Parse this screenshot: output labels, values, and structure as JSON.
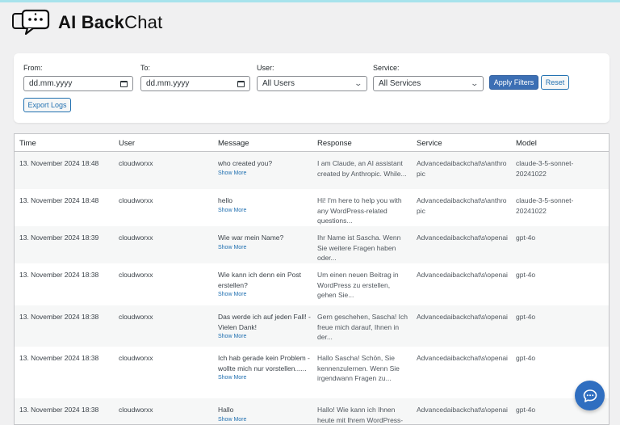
{
  "app": {
    "brand_bold": "AI Back",
    "brand_light": "Chat"
  },
  "filters": {
    "from_label": "From:",
    "from_value": "dd.mm.yyyy",
    "to_label": "To:",
    "to_value": "dd.mm.yyyy",
    "user_label": "User:",
    "user_value": "All Users",
    "service_label": "Service:",
    "service_value": "All Services",
    "apply_label": "Apply Filters",
    "reset_label": "Reset",
    "export_label": "Export Logs"
  },
  "table": {
    "headers": [
      "Time",
      "User",
      "Message",
      "Response",
      "Service",
      "Model"
    ],
    "show_more": "Show More",
    "rows": [
      {
        "time": "13. November 2024 18:48",
        "user": "cloudworxx",
        "message": "who created you?",
        "response": "I am Claude, an AI assistant created by Anthropic. While...",
        "service": "Advancedaibackchat\\s\\anthropic",
        "model": "claude-3-5-sonnet-20241022"
      },
      {
        "time": "13. November 2024 18:48",
        "user": "cloudworxx",
        "message": "hello",
        "response": "Hi! I'm here to help you with any WordPress-related questions...",
        "service": "Advancedaibackchat\\s\\anthropic",
        "model": "claude-3-5-sonnet-20241022"
      },
      {
        "time": "13. November 2024 18:39",
        "user": "cloudworxx",
        "message": "Wie war mein Name?",
        "response": "Ihr Name ist Sascha. Wenn Sie weitere Fragen haben oder...",
        "service": "Advancedaibackchat\\s\\openai",
        "model": "gpt-4o"
      },
      {
        "time": "13. November 2024 18:38",
        "user": "cloudworxx",
        "message": "Wie kann ich denn ein Post erstellen?",
        "response": "Um einen neuen Beitrag in WordPress zu erstellen, gehen Sie...",
        "service": "Advancedaibackchat\\s\\openai",
        "model": "gpt-4o"
      },
      {
        "time": "13. November 2024 18:38",
        "user": "cloudworxx",
        "message": "Das werde ich auf jeden Fall! - Vielen Dank!",
        "response": "Gern geschehen, Sascha! Ich freue mich darauf, Ihnen in der...",
        "service": "Advancedaibackchat\\s\\openai",
        "model": "gpt-4o"
      },
      {
        "time": "13. November 2024 18:38",
        "user": "cloudworxx",
        "message": "Ich hab gerade kein Problem - wollte mich nur vorstellen......",
        "response": "Hallo Sascha! Schön, Sie kennenzulernen. Wenn Sie irgendwann Fragen zu...",
        "service": "Advancedaibackchat\\s\\openai",
        "model": "gpt-4o"
      },
      {
        "time": "13. November 2024 18:38",
        "user": "cloudworxx",
        "message": "Hallo",
        "response": "Hallo! Wie kann ich Ihnen heute mit Ihrem WordPress-",
        "service": "Advancedaibackchat\\s\\openai",
        "model": "gpt-4o"
      }
    ]
  },
  "icons": {
    "logo": "chat-bubble-logo-icon",
    "calendar": "calendar-icon",
    "chevron": "chevron-down-icon",
    "chat_fab": "chat-icon"
  },
  "colors": {
    "primary": "#3c6fb4",
    "link": "#2271b1",
    "fab": "#2f6ec0",
    "background": "#f0f0f1"
  }
}
